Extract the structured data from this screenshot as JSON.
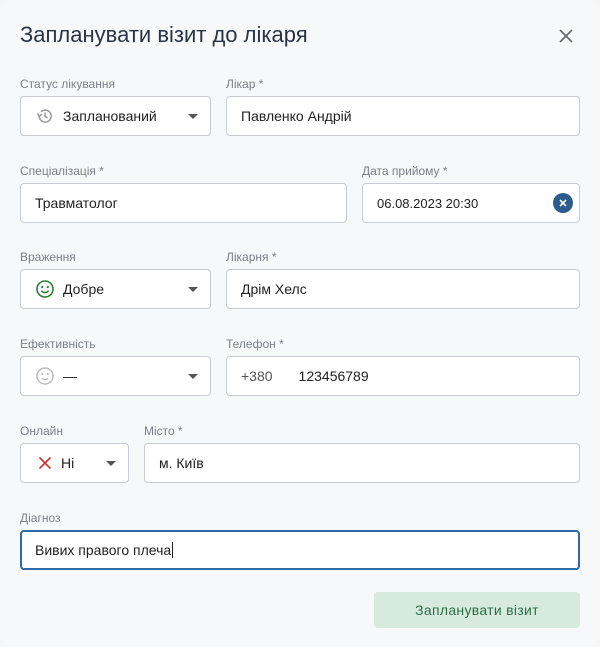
{
  "dialog": {
    "title": "Запланувати візит до лікаря",
    "submit_label": "Запланувати візит"
  },
  "fields": {
    "status": {
      "label": "Статус лікування",
      "value": "Запланований",
      "icon": "history-icon"
    },
    "doctor": {
      "label": "Лікар *",
      "value": "Павленко Андрій"
    },
    "specialization": {
      "label": "Спеціалізація *",
      "value": "Травматолог"
    },
    "date": {
      "label": "Дата прийому *",
      "value": "06.08.2023 20:30"
    },
    "impression": {
      "label": "Враження",
      "value": "Добре",
      "icon": "smile-icon",
      "icon_color": "#2e7d32"
    },
    "hospital": {
      "label": "Лікарня *",
      "value": "Дрім Хелс"
    },
    "effectiveness": {
      "label": "Ефективність",
      "value": "—",
      "icon": "neutral-face-icon"
    },
    "phone": {
      "label": "Телефон *",
      "prefix": "+380",
      "value": "123456789"
    },
    "online": {
      "label": "Онлайн",
      "value": "Ні",
      "icon": "cross-icon",
      "icon_color": "#d32f2f"
    },
    "city": {
      "label": "Місто *",
      "value": "м. Київ"
    },
    "diagnosis": {
      "label": "Діагноз",
      "value": "Вивих правого плеча"
    }
  },
  "colors": {
    "accent": "#2e6aa8",
    "submit_bg": "#d6ebdd",
    "submit_text": "#2f6e46"
  }
}
